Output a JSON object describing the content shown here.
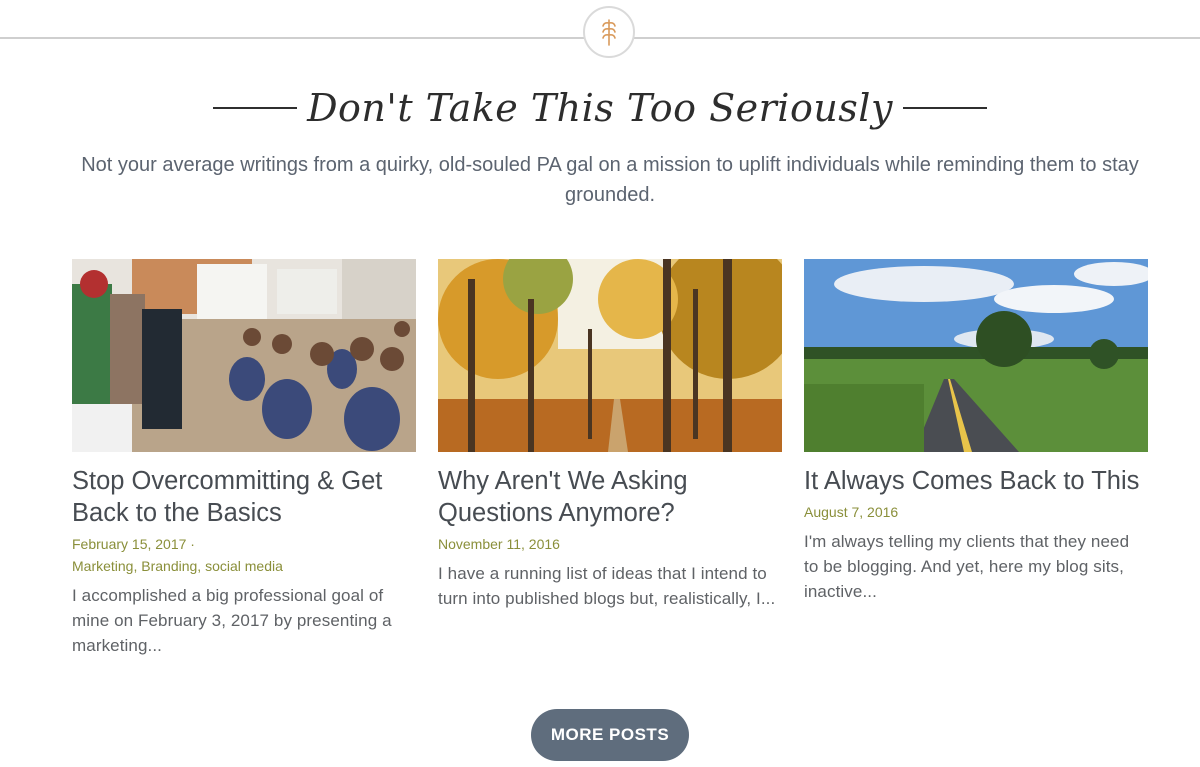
{
  "icons": {
    "emblem": "wheat-icon"
  },
  "section": {
    "title": "Don't Take This Too Seriously",
    "subtitle": "Not your average writings from a quirky, old-souled PA gal on a mission to uplift individuals while reminding them to stay grounded."
  },
  "posts": [
    {
      "title": "Stop Overcommitting & Get Back to the Basics",
      "date": "February 15, 2017",
      "date_sep": " ·",
      "categories": [
        "Marketing",
        "Branding",
        "social media"
      ],
      "excerpt": "I accomplished a big professional goal of mine on February 3, 2017 by presenting a marketing..."
    },
    {
      "title": "Why Aren't We Asking Questions Anymore?",
      "date": "November 11, 2016",
      "excerpt": "I have a running list of ideas that I intend to turn into published blogs but, realistically, I..."
    },
    {
      "title": "It Always Comes Back to This",
      "date": "August 7, 2016",
      "excerpt": "I'm always telling my clients that they need to be blogging. And yet, here my blog sits, inactive..."
    }
  ],
  "more_button": {
    "label": "MORE POSTS"
  },
  "colors": {
    "accent": "#8a8f3a",
    "button": "#5f6d7d",
    "emblem": "#d99a5b"
  }
}
